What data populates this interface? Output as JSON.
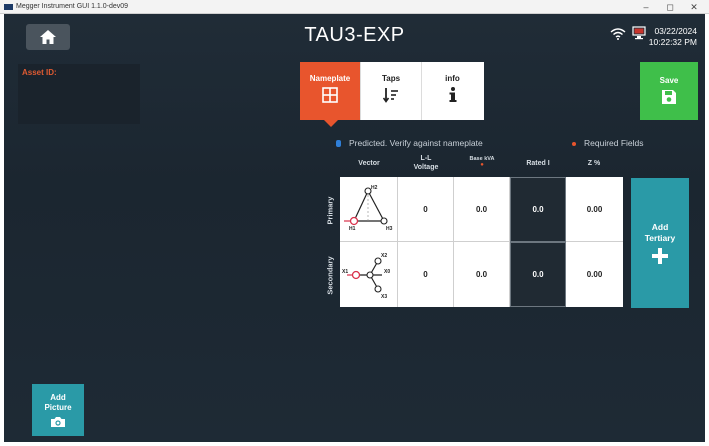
{
  "window": {
    "title": "Megger Instrument GUI 1.1.0-dev09",
    "controls": [
      "–",
      "◻",
      "✕"
    ]
  },
  "header": {
    "title": "TAU3-EXP",
    "date": "03/22/2024",
    "time": "10:22:32 PM"
  },
  "asset": {
    "label": "Asset ID:"
  },
  "tabs": [
    {
      "label": "Nameplate",
      "icon": "grid-icon",
      "active": true
    },
    {
      "label": "Taps",
      "icon": "sort-icon",
      "active": false
    },
    {
      "label": "info",
      "icon": "info-icon",
      "active": false
    }
  ],
  "save": {
    "label": "Save",
    "icon": "floppy-icon"
  },
  "legend": {
    "predicted": "Predicted. Verify against nameplate",
    "required": "Required Fields",
    "predicted_color": "#2f7fd8",
    "required_color": "#e8552d"
  },
  "table": {
    "headers": {
      "vector": "Vector",
      "ll_voltage_line1": "L-L",
      "ll_voltage_line2": "Voltage",
      "base_kva": "Base kVA",
      "rated_i": "Rated I",
      "z_percent": "Z %"
    },
    "rows": [
      {
        "label": "Primary",
        "ll_voltage": "0",
        "base_kva": "0.0",
        "rated_i": "0.0",
        "z_percent": "0.00"
      },
      {
        "label": "Secondary",
        "ll_voltage": "0",
        "base_kva": "0.0",
        "rated_i": "0.0",
        "z_percent": "0.00"
      }
    ],
    "primary_vector_labels": {
      "top": "H2",
      "left": "H1",
      "right": "H3"
    },
    "secondary_vector_labels": {
      "top": "X2",
      "left": "X1",
      "right": "X0",
      "bottom": "X3"
    }
  },
  "add_tertiary": {
    "line1": "Add",
    "line2": "Tertiary",
    "icon": "plus-icon"
  },
  "add_picture": {
    "line1": "Add",
    "line2": "Picture",
    "icon": "camera-icon"
  },
  "colors": {
    "accent_orange": "#e8552d",
    "save_green": "#3fbf4a",
    "teal": "#2a9aa7",
    "background": "#1e2a35"
  }
}
